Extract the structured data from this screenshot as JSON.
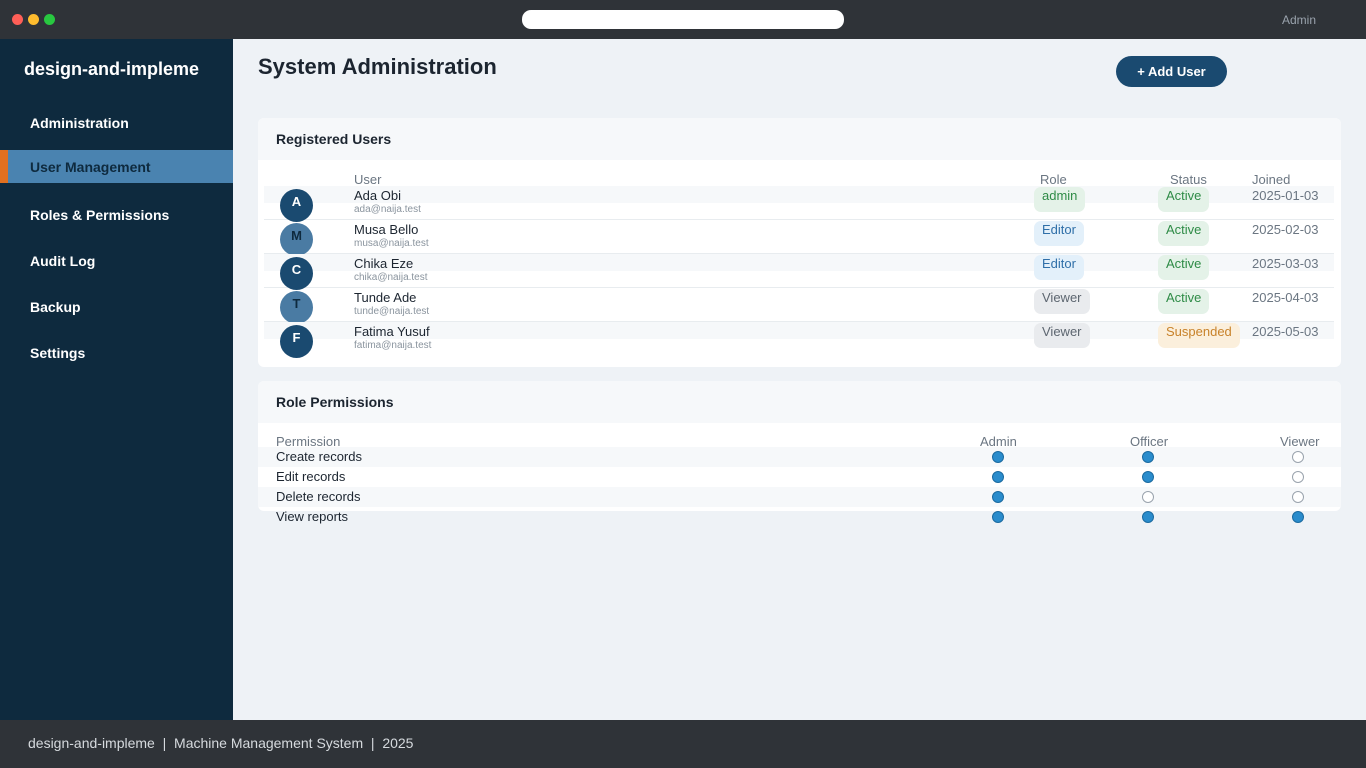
{
  "window": {
    "user_label": "Admin",
    "colors": {
      "close": "#ff5f57",
      "minimize": "#febc2e",
      "maximize": "#28c840"
    }
  },
  "sidebar": {
    "brand": "design-and-impleme",
    "items": [
      {
        "label": "Administration",
        "active": false
      },
      {
        "label": "User Management",
        "active": true
      },
      {
        "label": "Roles & Permissions",
        "active": false
      },
      {
        "label": "Audit Log",
        "active": false
      },
      {
        "label": "Backup",
        "active": false
      },
      {
        "label": "Settings",
        "active": false
      }
    ]
  },
  "header": {
    "title": "System Administration",
    "add_user_label": "+ Add User"
  },
  "users_card": {
    "title": "Registered Users",
    "columns": {
      "user": "User",
      "role": "Role",
      "status": "Status",
      "joined": "Joined"
    },
    "rows": [
      {
        "initial": "A",
        "name": "Ada Obi",
        "email": "ada@naija.test",
        "role": "admin",
        "status": "Active",
        "joined": "2025-01-03"
      },
      {
        "initial": "M",
        "name": "Musa Bello",
        "email": "musa@naija.test",
        "role": "Editor",
        "status": "Active",
        "joined": "2025-02-03"
      },
      {
        "initial": "C",
        "name": "Chika Eze",
        "email": "chika@naija.test",
        "role": "Editor",
        "status": "Active",
        "joined": "2025-03-03"
      },
      {
        "initial": "T",
        "name": "Tunde Ade",
        "email": "tunde@naija.test",
        "role": "Viewer",
        "status": "Active",
        "joined": "2025-04-03"
      },
      {
        "initial": "F",
        "name": "Fatima Yusuf",
        "email": "fatima@naija.test",
        "role": "Viewer",
        "status": "Suspended",
        "joined": "2025-05-03"
      }
    ]
  },
  "permissions_card": {
    "title": "Role Permissions",
    "columns": {
      "permission": "Permission",
      "admin": "Admin",
      "officer": "Officer",
      "viewer": "Viewer"
    },
    "rows": [
      {
        "label": "Create records",
        "admin": true,
        "officer": true,
        "viewer": false
      },
      {
        "label": "Edit records",
        "admin": true,
        "officer": true,
        "viewer": false
      },
      {
        "label": "Delete records",
        "admin": true,
        "officer": false,
        "viewer": false
      },
      {
        "label": "View reports",
        "admin": true,
        "officer": true,
        "viewer": true
      }
    ]
  },
  "footer": {
    "text": "design-and-impleme  |  Machine Management System  |  2025"
  }
}
